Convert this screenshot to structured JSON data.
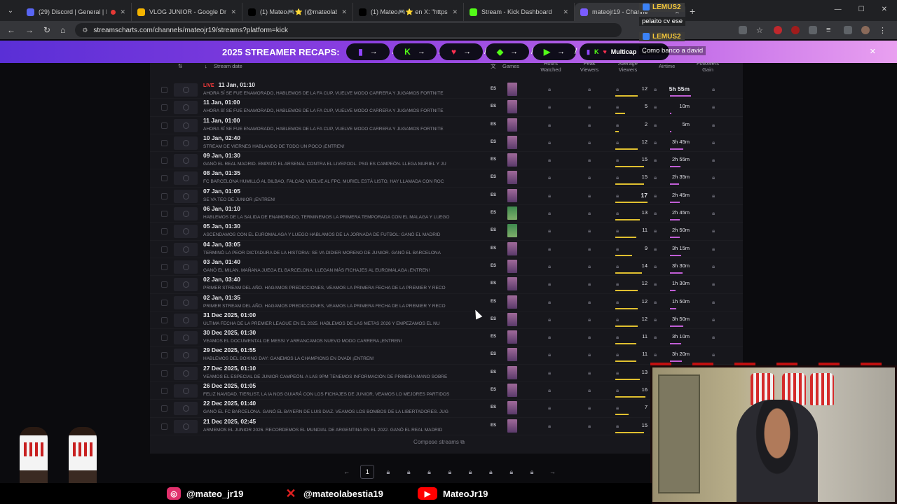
{
  "browser": {
    "tabs": [
      {
        "title": "(29) Discord | General | Ma",
        "icon": "discord-icon",
        "color": "#5865f2",
        "recording": true
      },
      {
        "title": "VLOG JUNIOR - Google Drive",
        "icon": "drive-icon",
        "color": "#f4b400"
      },
      {
        "title": "(1) Mateo🎮⭐ (@mateolabe",
        "icon": "x-icon",
        "color": "#000000"
      },
      {
        "title": "(1) Mateo🎮⭐ en X: \"https://...",
        "icon": "x-icon",
        "color": "#000000"
      },
      {
        "title": "Stream - Kick Dashboard",
        "icon": "kick-icon",
        "color": "#53fc18"
      },
      {
        "title": "mateojr19 - Channe",
        "icon": "streamscharts-icon",
        "color": "#7a5cff"
      }
    ],
    "url": "streamscharts.com/channels/mateojr19/streams?platform=kick"
  },
  "banner": {
    "title": "2025 STREAMER RECAPS:",
    "multicap": "Multicap",
    "platform_icons": [
      "twitch-icon",
      "kick-icon",
      "heart-icon",
      "gem-icon",
      "play-icon",
      "twitch-kick-icon"
    ]
  },
  "chat": [
    {
      "user": "LEMUS2",
      "message": "pelaito cv ese"
    },
    {
      "user": "LEMUS2",
      "message": "Como banco a david"
    }
  ],
  "table": {
    "headers": {
      "date": "Stream date",
      "games": "Games",
      "hours": "Hours Watched",
      "peak": "Peak Viewers",
      "avg": "Average Viewers",
      "airtime": "Airtime",
      "followers": "Followers Gain"
    },
    "live_label": "LIVE",
    "rows": [
      {
        "date": "11 Jan, 01:10",
        "title": "AHORA SÍ SE FUE ENAMORADO, HABLEMOS DE LA FA CUP, VUELVE MODO CARRERA Y JUGAMOS FORTNITE",
        "lang": "ES",
        "avg": "12",
        "air": "5h 55m",
        "live": true,
        "game": "g1"
      },
      {
        "date": "11 Jan, 01:00",
        "title": "AHORA SÍ SE FUE ENAMORADO, HABLEMOS DE LA FA CUP, VUELVE MODO CARRERA Y JUGAMOS FORTNITE",
        "lang": "ES",
        "avg": "5",
        "air": "10m",
        "game": "g1"
      },
      {
        "date": "11 Jan, 01:00",
        "title": "AHORA SÍ SE FUE ENAMORADO, HABLEMOS DE LA FA CUP, VUELVE MODO CARRERA Y JUGAMOS FORTNITE",
        "lang": "ES",
        "avg": "2",
        "air": "5m",
        "game": "g1"
      },
      {
        "date": "10 Jan, 02:40",
        "title": "STREAM DE VIERNES HABLANDO DE TODO UN POCO ¡ENTREN!",
        "lang": "ES",
        "avg": "12",
        "air": "3h 45m",
        "game": "g1"
      },
      {
        "date": "09 Jan, 01:30",
        "title": "GANÓ EL REAL MADRID. EMPATÓ EL ARSENAL CONTRA EL LIVEPOOL. PSG ES CAMPEÓN. LLEGA MURIEL Y JU",
        "lang": "ES",
        "avg": "15",
        "air": "2h 55m",
        "game": "g1"
      },
      {
        "date": "08 Jan, 01:35",
        "title": "FC BARCELONA HUMILLÓ AL BILBAO, FALCAO VUELVE AL FPC, MURIEL ESTÁ LISTO, HAY LLAMADA CON ROC",
        "lang": "ES",
        "avg": "15",
        "air": "2h 35m",
        "game": "g1"
      },
      {
        "date": "07 Jan, 01:05",
        "title": "SE VA TEO DE JUNIOR ¡ENTREN!",
        "lang": "ES",
        "avg": "17",
        "air": "2h 45m",
        "big": true,
        "game": "g1"
      },
      {
        "date": "06 Jan, 01:10",
        "title": "HABLEMOS DE LA SALIDA DE ENAMORADO, TERMINEMOS LA PRIMERA TEMPORADA CON EL MALAGA Y LUEGO",
        "lang": "ES",
        "avg": "13",
        "air": "2h 45m",
        "game": "g2"
      },
      {
        "date": "05 Jan, 01:30",
        "title": "ASCENDAMOS CON EL EUROMALAGA Y LUEGO HABLAMOS DE LA JORNADA DE FUTBOL: GANÓ EL MADRID",
        "lang": "ES",
        "avg": "11",
        "air": "2h 50m",
        "game": "g2"
      },
      {
        "date": "04 Jan, 03:05",
        "title": "TERMINÓ LA PEOR DICTADURA DE LA HISTORIA: SE VA DIDIER MORENO DE JUNIOR. GANÓ EL BARCELONA",
        "lang": "ES",
        "avg": "9",
        "air": "3h 15m",
        "game": "g1"
      },
      {
        "date": "03 Jan, 01:40",
        "title": "GANÓ EL MILAN. MAÑANA JUEGA EL BARCELONA. LLEGAN MÁS FICHAJES AL EUROMALAGA ¡ENTREN!",
        "lang": "ES",
        "avg": "14",
        "air": "3h 30m",
        "game": "g1"
      },
      {
        "date": "02 Jan, 03:40",
        "title": "PRIMER STREAM DEL AÑO. HAGAMOS PREDICCIONES, VEAMOS LA PRIMERA FECHA DE LA PREMIER Y RECO",
        "lang": "ES",
        "avg": "12",
        "air": "1h 30m",
        "game": "g1"
      },
      {
        "date": "02 Jan, 01:35",
        "title": "PRIMER STREAM DEL AÑO. HAGAMOS PREDICCIONES, VEAMOS LA PRIMERA FECHA DE LA PREMIER Y RECO",
        "lang": "ES",
        "avg": "12",
        "air": "1h 50m",
        "game": "g1"
      },
      {
        "date": "31 Dec 2025, 01:00",
        "title": "ÚLTIMA FECHA DE LA PREMIER LEAGUE EN EL 2025. HABLEMOS DE LAS METAS 2026 Y EMPEZAMOS EL NU",
        "lang": "ES",
        "avg": "12",
        "air": "3h 50m",
        "game": "g1"
      },
      {
        "date": "30 Dec 2025, 01:30",
        "title": "VEAMOS EL DOCUMENTAL DE MESSI Y ARRANCAMOS NUEVO MODO CARRERA ¡ENTREN!",
        "lang": "ES",
        "avg": "11",
        "air": "3h 10m",
        "game": "g1"
      },
      {
        "date": "29 Dec 2025, 01:55",
        "title": "HABLEMOS DEL BOXING DAY: GANEMOS LA CHAMPIONS EN DVADI ¡ENTREN!",
        "lang": "ES",
        "avg": "11",
        "air": "3h 20m",
        "game": "g1"
      },
      {
        "date": "27 Dec 2025, 01:10",
        "title": "VEAMOS EL ESPECIAL DE JUNIOR CAMPEÓN. A LAS 9PM TENEMOS INFORMACIÓN DE PRIMERA MANO SOBRE",
        "lang": "ES",
        "avg": "13",
        "air": "",
        "game": "g1"
      },
      {
        "date": "26 Dec 2025, 01:05",
        "title": "FELIZ NAVIDAD. TIERLIST, LA IA NOS GUIARÁ CON LOS FICHAJES DE JUNIOR, VEAMOS LO MEJORES PARTIDOS",
        "lang": "ES",
        "avg": "16",
        "air": "",
        "game": "g1"
      },
      {
        "date": "22 Dec 2025, 01:40",
        "title": "GANÓ EL FC BARCELONA. GANÓ EL BAYERN DE LUIS DIAZ. VEAMOS LOS BOMBOS DE LA LIBERTADORES. JUG",
        "lang": "ES",
        "avg": "7",
        "air": "",
        "game": "g1"
      },
      {
        "date": "21 Dec 2025, 02:45",
        "title": "ARMEMOS EL JUNIOR 2026. RECORDEMOS EL MUNDIAL DE ARGENTINA EN EL 2022. GANÓ EL REAL MADRID",
        "lang": "ES",
        "avg": "15",
        "air": "",
        "game": "g1"
      }
    ],
    "compose": "Compose streams"
  },
  "pagination": {
    "current": "1",
    "prev": "←",
    "next": "→"
  },
  "socials": [
    {
      "handle": "@mateo_jr19",
      "icon": "instagram-icon",
      "color": "#e1306c"
    },
    {
      "handle": "@mateolabestia19",
      "icon": "x-icon",
      "color": "#e02020"
    },
    {
      "handle": "MateoJr19",
      "icon": "youtube-icon",
      "color": "#ff0000"
    }
  ]
}
